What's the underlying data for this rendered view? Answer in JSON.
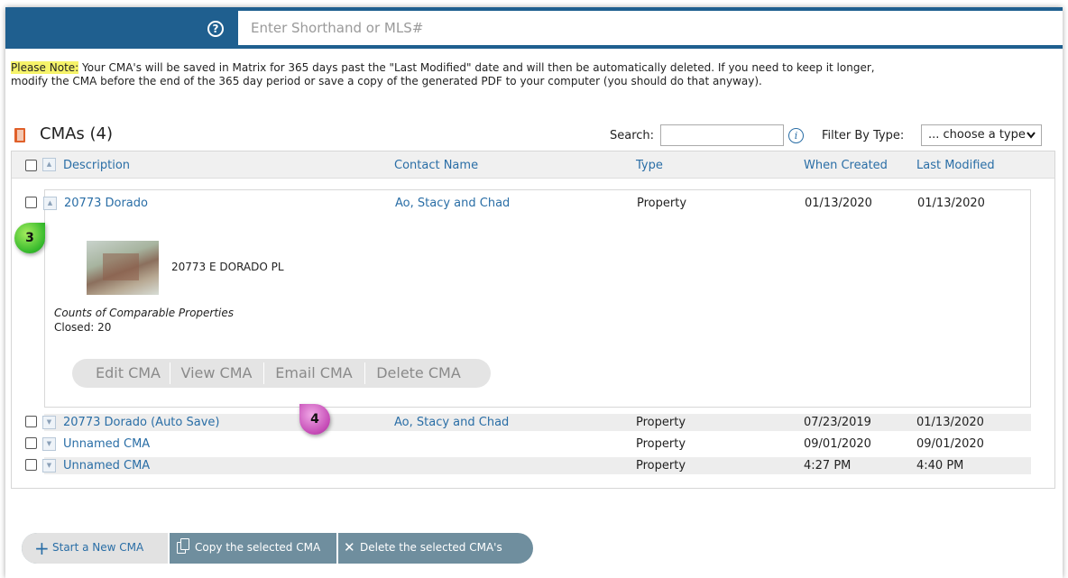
{
  "topbar": {
    "help_icon": "?",
    "search_placeholder": "Enter Shorthand or MLS#"
  },
  "note": {
    "label": "Please Note:",
    "text": " Your CMA's will be saved in Matrix for 365 days past the \"Last Modified\" date and will then be automatically deleted. If you need to keep it longer, modify the CMA before the end of the 365 day period or save a copy of the generated PDF to your computer (you should do that anyway)."
  },
  "cmas": {
    "title": "CMAs (4)",
    "search_label": "Search:",
    "info_icon": "i",
    "filter_label": "Filter By Type:",
    "filter_value": "... choose a type",
    "columns": {
      "description": "Description",
      "contact": "Contact Name",
      "type": "Type",
      "created": "When Created",
      "modified": "Last Modified"
    },
    "rows": [
      {
        "description": "20773 Dorado",
        "contact": "Ao, Stacy and Chad",
        "type": "Property",
        "created": "01/13/2020",
        "modified": "01/13/2020"
      },
      {
        "description": "20773 Dorado (Auto Save)",
        "contact": "Ao, Stacy and Chad",
        "type": "Property",
        "created": "07/23/2019",
        "modified": "01/13/2020"
      },
      {
        "description": "Unnamed CMA",
        "contact": "",
        "type": "Property",
        "created": "09/01/2020",
        "modified": "09/01/2020"
      },
      {
        "description": "Unnamed CMA",
        "contact": "",
        "type": "Property",
        "created": "4:27 PM",
        "modified": "4:40 PM"
      }
    ],
    "expanded": {
      "address": "20773 E DORADO PL",
      "counts_label": "Counts of Comparable Properties",
      "closed": "Closed: 20",
      "buttons": {
        "edit": "Edit CMA",
        "view": "View CMA",
        "email": "Email CMA",
        "delete": "Delete CMA"
      }
    }
  },
  "badges": {
    "three": "3",
    "four": "4"
  },
  "actions": {
    "plus": "+",
    "start_new": "Start a New CMA",
    "copy_selected": "Copy the selected CMA",
    "delete_x": "✕",
    "delete_selected": "Delete the selected CMA's"
  },
  "colors": {
    "topbar": "#1f5f8f",
    "link": "#2a6ea6",
    "highlight": "#f6f36a",
    "action_bar": "#6f8e9e"
  }
}
